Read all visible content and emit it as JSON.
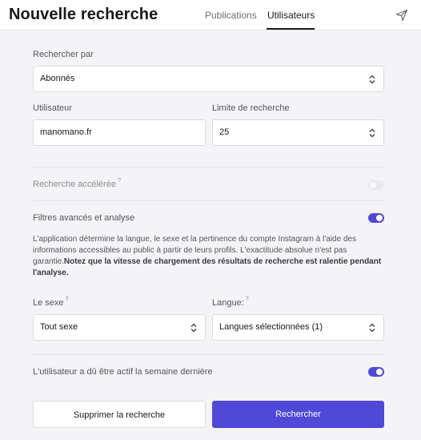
{
  "header": {
    "title": "Nouvelle recherche",
    "tabs": [
      {
        "label": "Publications",
        "active": false
      },
      {
        "label": "Utilisateurs",
        "active": true
      }
    ],
    "send_icon": "send-icon"
  },
  "form": {
    "search_by": {
      "label": "Rechercher par",
      "value": "Abonnés"
    },
    "user": {
      "label": "Utilisateur",
      "value": "manomano.fr"
    },
    "limit": {
      "label": "Limite de recherche",
      "value": "25"
    },
    "accelerated": {
      "label": "Recherche accélérée",
      "hint": "?",
      "enabled": false
    },
    "advanced": {
      "label": "Filtres avancés et analyse",
      "enabled": true,
      "description": "L'application détermine la langue, le sexe et la pertinence du compte Instagram à l'aide des informations accessibles au public à partir de leurs profils. L'exactitude absolue n'est pas garantie.",
      "description_bold": "Notez que la vitesse de chargement des résultats de recherche est ralentie pendant l'analyse."
    },
    "gender": {
      "label": "Le sexe",
      "hint": "?",
      "value": "Tout sexe"
    },
    "language": {
      "label": "Langue:",
      "hint": "?",
      "value": "Langues sélectionnées (1)"
    },
    "active_last_week": {
      "label": "L'utilisateur a dû être actif la semaine dernière",
      "enabled": true
    }
  },
  "buttons": {
    "clear": "Supprimer la recherche",
    "search": "Rechercher"
  },
  "colors": {
    "accent": "#5048d6",
    "background": "#f4f4f6"
  }
}
